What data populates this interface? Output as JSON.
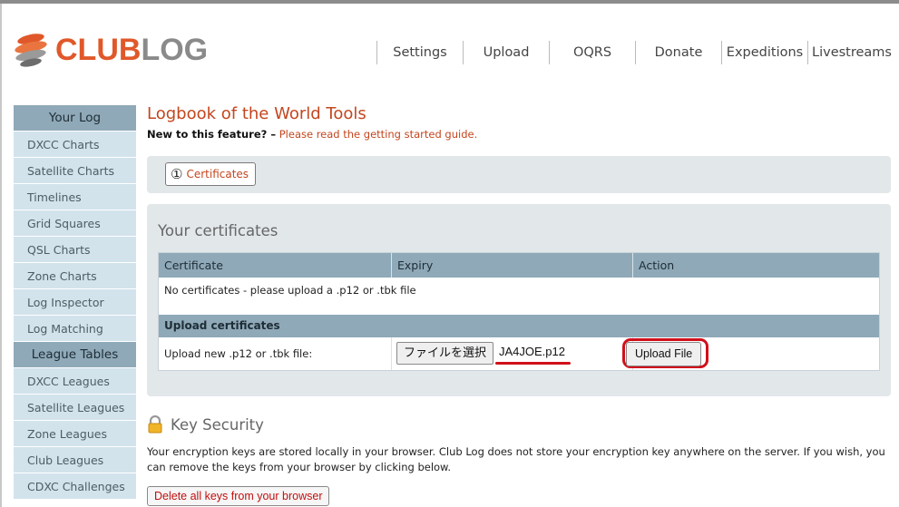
{
  "logo": {
    "part1": "CLUB",
    "part2": "LOG"
  },
  "nav": {
    "items": [
      {
        "label": "Settings"
      },
      {
        "label": "Upload"
      },
      {
        "label": "OQRS"
      },
      {
        "label": "Donate"
      },
      {
        "label": "Expeditions"
      },
      {
        "label": "Livestreams"
      }
    ]
  },
  "sidebar": {
    "section1_title": "Your Log",
    "section1_items": [
      {
        "label": "DXCC Charts"
      },
      {
        "label": "Satellite Charts"
      },
      {
        "label": "Timelines"
      },
      {
        "label": "Grid Squares"
      },
      {
        "label": "QSL Charts"
      },
      {
        "label": "Zone Charts"
      },
      {
        "label": "Log Inspector"
      },
      {
        "label": "Log Matching"
      }
    ],
    "section2_title": "League Tables",
    "section2_items": [
      {
        "label": "DXCC Leagues"
      },
      {
        "label": "Satellite Leagues"
      },
      {
        "label": "Zone Leagues"
      },
      {
        "label": "Club Leagues"
      },
      {
        "label": "CDXC Challenges"
      }
    ]
  },
  "main": {
    "title": "Logbook of the World Tools",
    "intro_lead": "New to this feature? –",
    "intro_link": "Please read the getting started guide.",
    "tab": {
      "number": "①",
      "label": "Certificates"
    },
    "certs_title": "Your certificates",
    "table": {
      "headers": [
        "Certificate",
        "Expiry",
        "Action"
      ],
      "empty_message": "No certificates - please upload a .p12 or .tbk file",
      "upload_section": "Upload certificates",
      "upload_label": "Upload new .p12 or .tbk file:",
      "file_button": "ファイルを選択",
      "file_name": "JA4JOE.p12",
      "upload_button": "Upload File"
    },
    "key_security": {
      "title": "Key Security",
      "description": "Your encryption keys are stored locally in your browser. Club Log does not store your encryption key anywhere on the server. If you wish, you can remove the keys from your browser by clicking below.",
      "delete_button": "Delete all keys from your browser"
    }
  },
  "colors": {
    "accent": "#c3461e",
    "sidebar_head": "#8fa9b8",
    "sidebar_item": "#d2e3ec",
    "panel": "#e2e7ea",
    "highlight": "#d0101a"
  }
}
